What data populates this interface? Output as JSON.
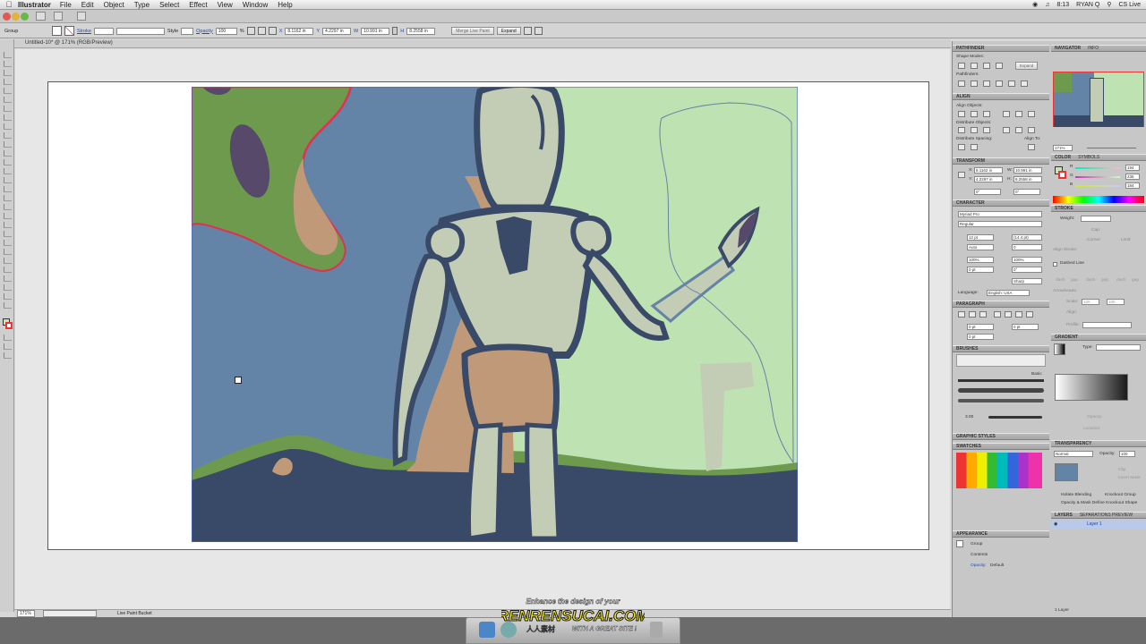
{
  "menubar": {
    "app": "Illustrator",
    "items": [
      "File",
      "Edit",
      "Object",
      "Type",
      "Select",
      "Effect",
      "View",
      "Window",
      "Help"
    ],
    "clock": "8:13",
    "user": "RYAN Q",
    "cslive": "CS Live"
  },
  "control": {
    "selection": "Group",
    "stroke_label": "Stroke",
    "style_label": "Style",
    "opacity_label": "Opacity",
    "opacity": "100",
    "opacity_unit": "%",
    "x_label": "X",
    "x": "8.1162 in",
    "y_label": "Y",
    "y": "4.2297 in",
    "w_label": "W",
    "w": "10.991 in",
    "h_label": "H",
    "h": "8.2558 in",
    "merge_button": "Merge Live Paint",
    "expand_button": "Expand"
  },
  "document": {
    "tab": "Untitled-10* @ 171% (RGB/Preview)"
  },
  "status": {
    "zoom": "171%",
    "tool": "Live Paint Bucket"
  },
  "panels": {
    "pathfinder": {
      "title": "PATHFINDER",
      "shape_modes": "Shape Modes:",
      "expand": "Expand",
      "pathfinders": "Pathfinders:"
    },
    "navigator": {
      "title": "NAVIGATOR",
      "info": "INFO",
      "zoom": "171%"
    },
    "align": {
      "title": "ALIGN",
      "objects": "Align Objects:",
      "distribute": "Distribute Objects:",
      "spacing": "Distribute Spacing:",
      "align_to": "Align To:"
    },
    "transform": {
      "title": "TRANSFORM",
      "x_label": "X:",
      "x": "8.1162 in",
      "w_label": "W:",
      "w": "10.991 in",
      "y_label": "Y:",
      "y": "4.2297 in",
      "h_label": "H:",
      "h": "8.2558 in",
      "rot": "0°",
      "shear": "0°"
    },
    "color": {
      "title": "COLOR",
      "symbols": "SYMBOLS",
      "r_label": "R",
      "r": "194",
      "g_label": "G",
      "g": "235",
      "b_label": "B",
      "b": "184"
    },
    "character": {
      "title": "CHARACTER",
      "font": "Myriad Pro",
      "style": "Regular",
      "size": "12 pt",
      "leading": "(14.4 pt)",
      "kerning": "Auto",
      "tracking": "0",
      "hscale": "100%",
      "vscale": "100%",
      "baseline": "0 pt",
      "rotate": "0°",
      "aa": "Sharp",
      "language_label": "Language:",
      "language": "English: USA"
    },
    "stroke": {
      "title": "STROKE",
      "weight_label": "Weight:",
      "cap": "Cap:",
      "corner": "Corner:",
      "limit": "Limit:",
      "align_stroke": "Align Stroke:",
      "dashed": "Dashed Line",
      "dash_labels": [
        "dash",
        "gap",
        "dash",
        "gap",
        "dash",
        "gap"
      ],
      "arrowheads": "Arrowheads:",
      "scale_label": "Scale:",
      "scale_a": "100",
      "scale_b": "100",
      "align_label": "Align:",
      "profile": "Profile:"
    },
    "paragraph": {
      "title": "PARAGRAPH",
      "indent_a": "0 pt",
      "indent_b": "0 pt",
      "indent_c": "0 pt",
      "space": "0 pt"
    },
    "gradient": {
      "title": "GRADIENT",
      "type_label": "Type:",
      "opacity_label": "Opacity:",
      "location_label": "Location:"
    },
    "brushes": {
      "title": "BRUSHES",
      "basic": "Basic",
      "size": "3.00"
    },
    "graphic_styles": {
      "title": "GRAPHIC STYLES"
    },
    "swatches": {
      "title": "SWATCHES"
    },
    "transparency": {
      "title": "TRANSPARENCY",
      "mode": "Normal",
      "opacity_label": "Opacity:",
      "opacity": "100",
      "clip": "Clip",
      "invert": "Invert Mask",
      "isolate": "Isolate Blending",
      "knockout": "Knockout Group",
      "define": "Opacity & Mask Define Knockout Shape"
    },
    "layers": {
      "title": "LAYERS",
      "separations": "SEPARATIONS PREVIEW",
      "layer1": "Layer 1",
      "count": "1 Layer"
    },
    "appearance": {
      "title": "APPEARANCE",
      "group": "Group",
      "contents": "Contents",
      "opacity_label": "Opacity:",
      "opacity_value": "Default"
    }
  },
  "watermark": {
    "line1": "Enhance the design of your",
    "line2": "RENRENSUCAI.COM",
    "line3": "WITH A GREAT SITE !",
    "cn": "人人素材"
  },
  "colors": {
    "blue_bg": "#6384a6",
    "light_green": "#bfe2b2",
    "green": "#6e9a4e",
    "tan": "#c09a78",
    "dark_navy": "#394968",
    "pale": "#c3ccb5",
    "purple": "#56496a",
    "red_edge": "#e2304f"
  }
}
